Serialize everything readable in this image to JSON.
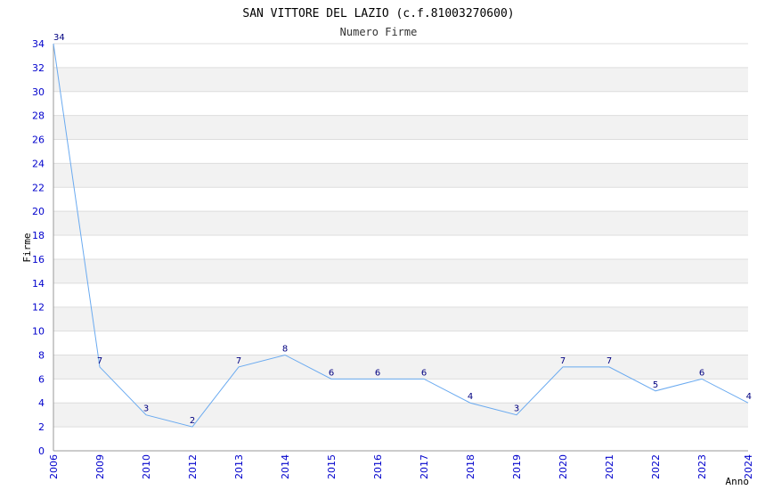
{
  "chart_data": {
    "type": "line",
    "title": "SAN VITTORE DEL LAZIO (c.f.81003270600)",
    "subtitle": "Numero Firme",
    "xlabel": "Anno",
    "ylabel": "Firme",
    "categories": [
      "2006",
      "2009",
      "2010",
      "2012",
      "2013",
      "2014",
      "2015",
      "2016",
      "2017",
      "2018",
      "2019",
      "2020",
      "2021",
      "2022",
      "2023",
      "2024"
    ],
    "values": [
      34,
      7,
      3,
      2,
      7,
      8,
      6,
      6,
      6,
      4,
      3,
      7,
      7,
      5,
      6,
      4
    ],
    "ylim": [
      0,
      34
    ],
    "yticks": [
      0,
      2,
      4,
      6,
      8,
      10,
      12,
      14,
      16,
      18,
      20,
      22,
      24,
      26,
      28,
      30,
      32,
      34
    ],
    "grid": true,
    "colors": {
      "line": "#6aaaf0",
      "band": "#f2f2f2",
      "grid": "#dddddd",
      "tick": "#0000cc",
      "label": "#000080"
    }
  }
}
